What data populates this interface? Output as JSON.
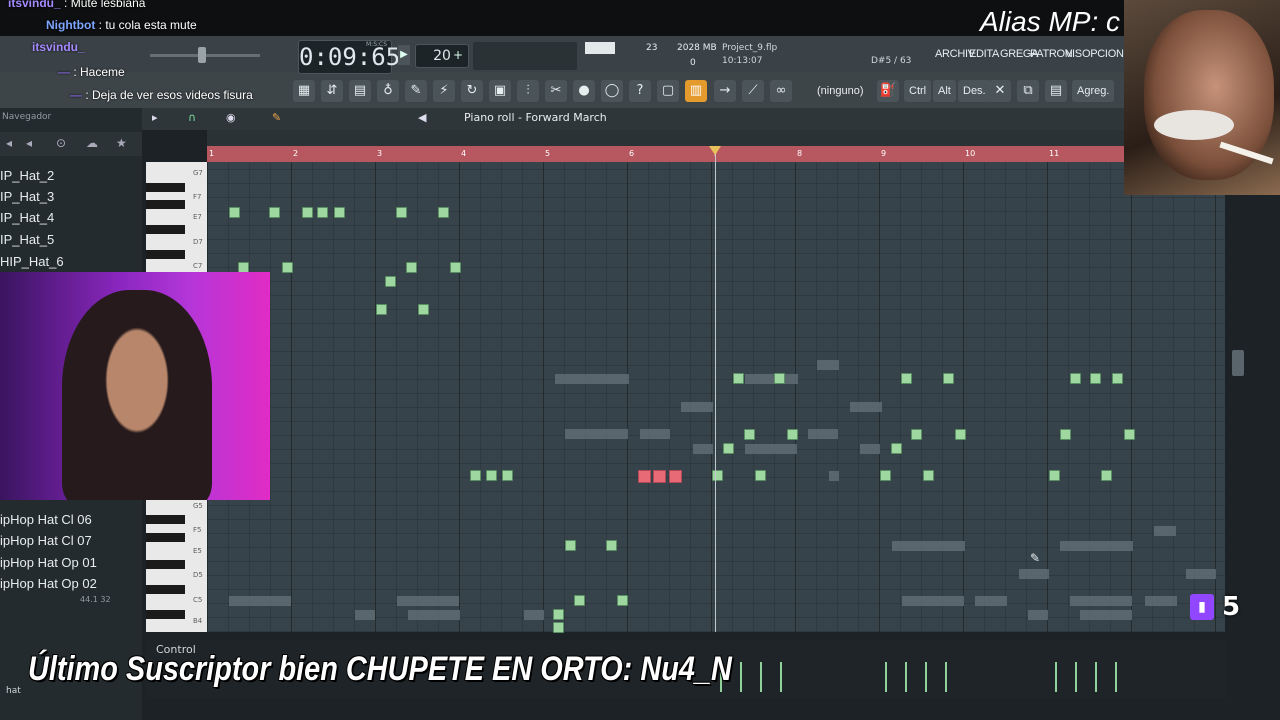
{
  "chat": [
    {
      "user": "itsvindu_",
      "message": "Mute lesbiana"
    },
    {
      "user": "Nightbot",
      "message": "tu cola esta mute"
    },
    {
      "user": "itsvindu_",
      "message": ""
    },
    {
      "user": "—",
      "message": "Haceme"
    },
    {
      "user": "—",
      "message": "Deja de ver esos videos fisura"
    }
  ],
  "transport": {
    "time": "0:09:65",
    "time_label": "M:S:CS",
    "tempo": "20",
    "cpu": "23",
    "memory": "2028 MB",
    "poly": "0",
    "project_name": "Project_9.flp",
    "project_time": "10:13:07",
    "note_hint": "D#5 / 63"
  },
  "menu": [
    "ARCHIV",
    "EDITA",
    "GREGA",
    "PATRON",
    "VIS",
    "OPCIONES"
  ],
  "tools": {
    "none_label": "(ninguno)",
    "ctrl": "Ctrl",
    "alt": "Alt",
    "des": "Des.",
    "agreg": "Agreg."
  },
  "piano_roll": {
    "title": "Piano roll - Forward March",
    "bar_numbers": [
      "1",
      "2",
      "3",
      "4",
      "5",
      "6",
      "7",
      "8",
      "9",
      "10",
      "11"
    ],
    "key_labels": [
      "G7",
      "F7",
      "E7",
      "D7",
      "C7",
      "G5",
      "F5",
      "E5",
      "D5",
      "C5",
      "B4"
    ],
    "control_label": "Control"
  },
  "browser": {
    "header": "Navegador",
    "items_top": [
      "IP_Hat_2",
      "IP_Hat_3",
      "IP_Hat_4",
      "IP_Hat_5",
      "HIP_Hat_6"
    ],
    "items_bottom": [
      "ipHop Hat Cl 06",
      "ipHop Hat Cl 07",
      "ipHop Hat Op 01",
      "ipHop Hat Op 02"
    ],
    "sample_info": "44.1  32",
    "search_text": "hat"
  },
  "overlay": {
    "alias": "Alias MP: c",
    "banner": "Último Suscriptor bien CHUPETE EN ORTO: Nu4_N",
    "twitch_count": "5"
  }
}
